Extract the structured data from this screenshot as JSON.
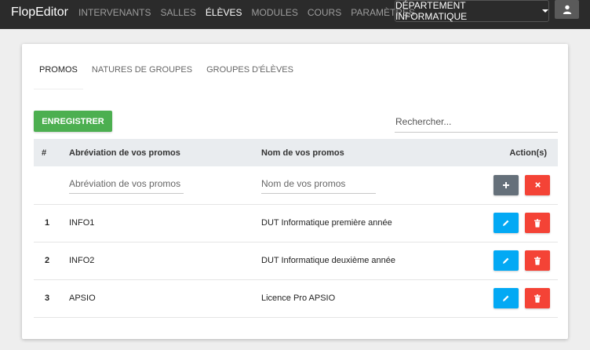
{
  "app": {
    "brand": "FlopEditor"
  },
  "nav": {
    "items": [
      {
        "label": "Intervenants"
      },
      {
        "label": "Salles"
      },
      {
        "label": "Élèves"
      },
      {
        "label": "Modules"
      },
      {
        "label": "Cours"
      },
      {
        "label": "Paramètres"
      }
    ],
    "department": "Département informatique"
  },
  "tabs": [
    {
      "label": "Promos"
    },
    {
      "label": "Natures de groupes"
    },
    {
      "label": "Groupes d'élèves"
    }
  ],
  "toolbar": {
    "save_label": "Enregistrer",
    "search_placeholder": "Rechercher..."
  },
  "table": {
    "headers": {
      "num": "#",
      "abbr": "Abréviation de vos promos",
      "name": "Nom de vos promos",
      "actions": "Action(s)"
    },
    "new_row": {
      "abbr_placeholder": "Abréviation de vos promos",
      "name_placeholder": "Nom de vos promos"
    },
    "rows": [
      {
        "num": "1",
        "abbr": "INFO1",
        "name": "DUT Informatique première année"
      },
      {
        "num": "2",
        "abbr": "INFO2",
        "name": "DUT Informatique deuxième année"
      },
      {
        "num": "3",
        "abbr": "APSIO",
        "name": "Licence Pro APSIO"
      }
    ]
  },
  "colors": {
    "navbar": "#2b2b2b",
    "save": "#4caf50",
    "edit": "#03a9f4",
    "delete": "#f44336",
    "add": "#65707a"
  }
}
